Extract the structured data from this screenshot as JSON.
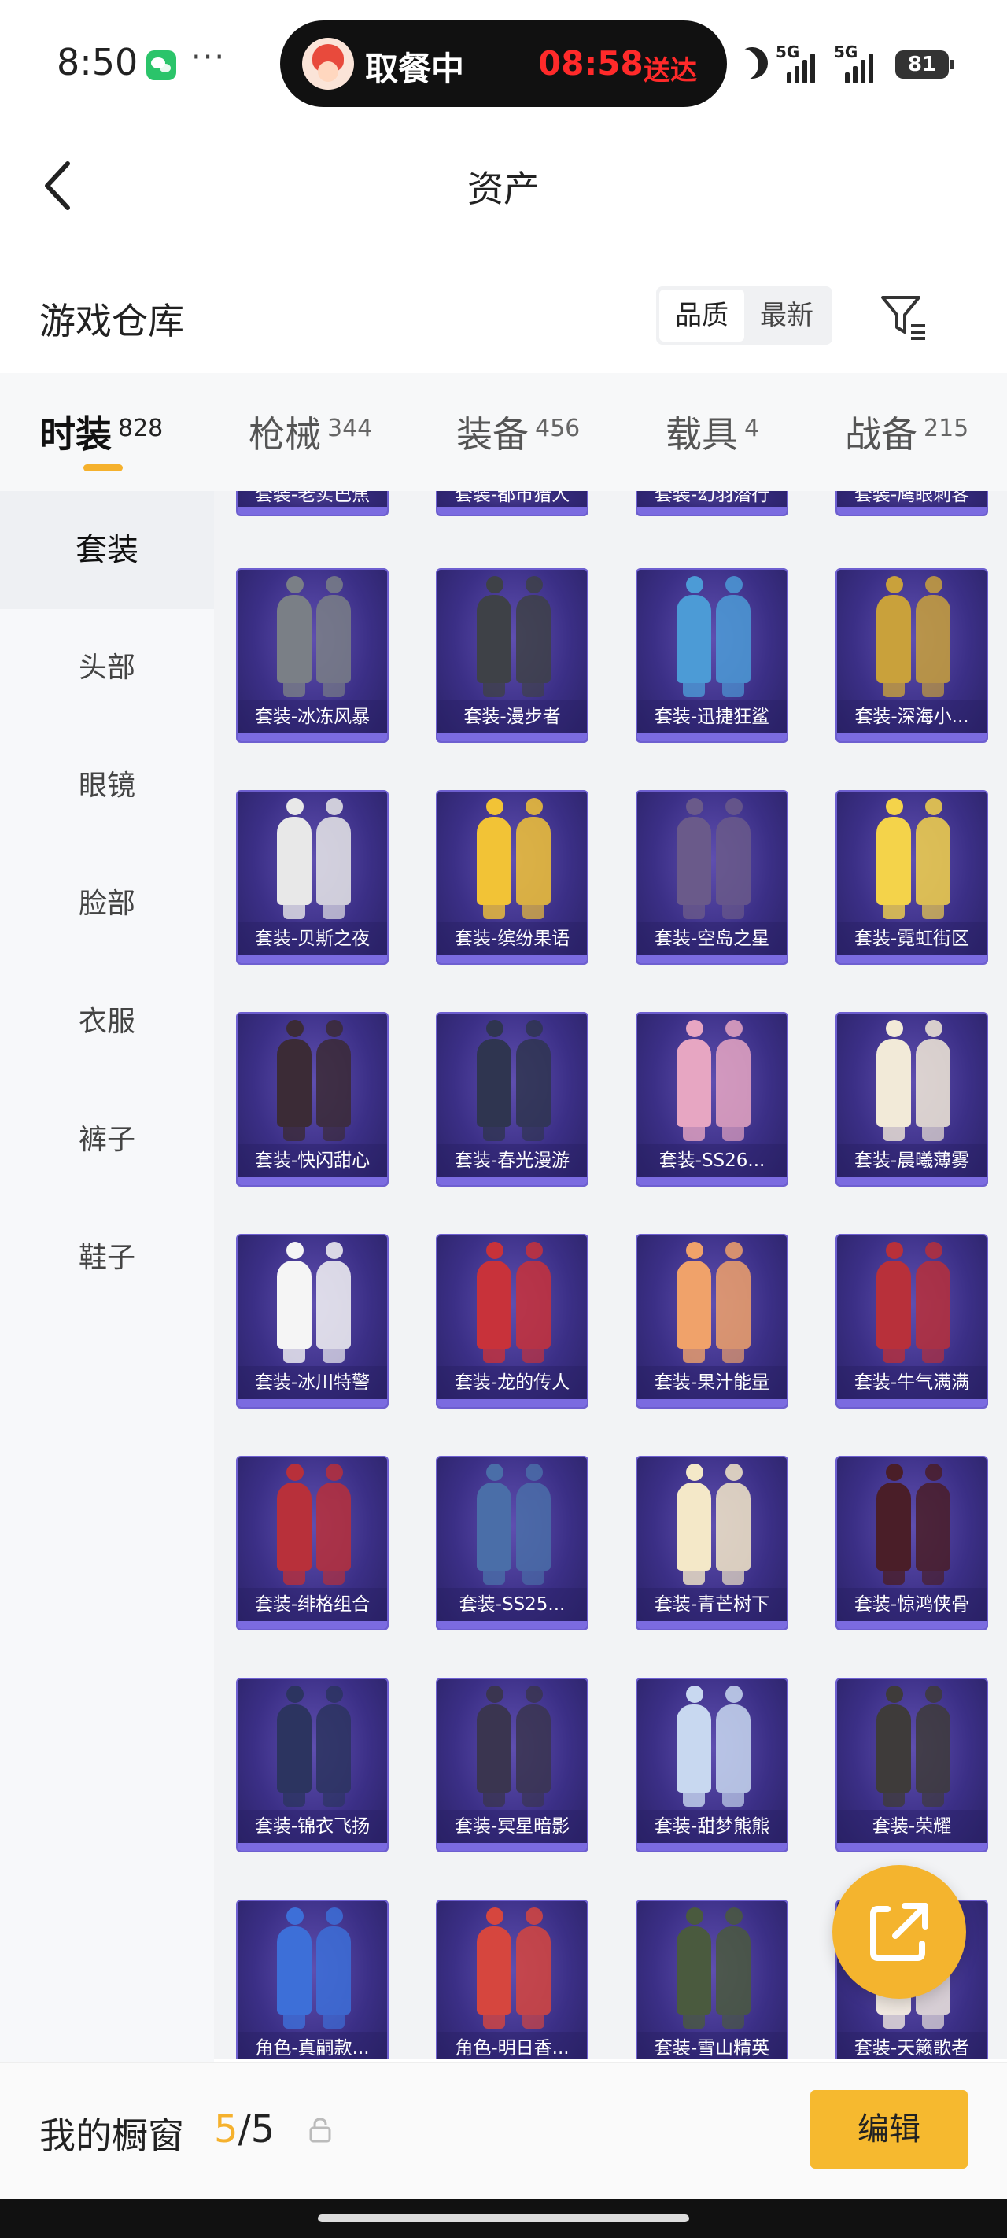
{
  "status_bar": {
    "time": "8:50",
    "more": "···",
    "island_title": "取餐中",
    "island_timer": "08:58",
    "island_tag": "送达",
    "signal_1": "5G",
    "signal_2": "5G",
    "battery": "81"
  },
  "header": {
    "title": "资产"
  },
  "warehouse": {
    "title": "游戏仓库",
    "sort_quality": "品质",
    "sort_newest": "最新"
  },
  "tabs": [
    {
      "label": "时装",
      "count": "828",
      "active": true
    },
    {
      "label": "枪械",
      "count": "344"
    },
    {
      "label": "装备",
      "count": "456"
    },
    {
      "label": "载具",
      "count": "4"
    },
    {
      "label": "战备",
      "count": "215"
    }
  ],
  "sidebar": {
    "items": [
      {
        "label": "套装",
        "active": true
      },
      {
        "label": "头部"
      },
      {
        "label": "眼镜"
      },
      {
        "label": "脸部"
      },
      {
        "label": "衣服"
      },
      {
        "label": "裤子"
      },
      {
        "label": "鞋子"
      }
    ]
  },
  "grid": {
    "partial_row": [
      "套装-老实巴焦",
      "套装-都市猎人",
      "套装-幻羽潜行",
      "套装-鹰眼刺客"
    ],
    "items": [
      [
        "套装-冰冻风暴",
        "套装-漫步者",
        "套装-迅捷狂鲨",
        "套装-深海小..."
      ],
      [
        "套装-贝斯之夜",
        "套装-缤纷果语",
        "套装-空岛之星",
        "套装-霓虹街区"
      ],
      [
        "套装-快闪甜心",
        "套装-春光漫游",
        "套装-SS26...",
        "套装-晨曦薄雾"
      ],
      [
        "套装-冰川特警",
        "套装-龙的传人",
        "套装-果汁能量",
        "套装-牛气满满"
      ],
      [
        "套装-绯格组合",
        "套装-SS25...",
        "套装-青芒树下",
        "套装-惊鸿侠骨"
      ],
      [
        "套装-锦衣飞扬",
        "套装-冥星暗影",
        "套装-甜梦熊熊",
        "套装-荣耀"
      ],
      [
        "角色-真嗣款...",
        "角色-明日香...",
        "套装-雪山精英",
        "套装-天籁歌者"
      ]
    ],
    "figure_colors": [
      [
        "#7a7f86",
        "#3e4147",
        "#4c9bd6",
        "#c9a13b"
      ],
      [
        "#e8e8e8",
        "#f2c336",
        "#6a5a8a",
        "#f4d34a"
      ],
      [
        "#3b2b36",
        "#2f3550",
        "#e7a6c2",
        "#f2ead8"
      ],
      [
        "#f5f5f5",
        "#c8323a",
        "#f0a26a",
        "#b8303a"
      ],
      [
        "#b8303a",
        "#4a6ea8",
        "#f4e8c8",
        "#4a1e28"
      ],
      [
        "#2c3460",
        "#3a3550",
        "#c8d8f0",
        "#3e3b3a"
      ],
      [
        "#3d6fd8",
        "#d6463e",
        "#4a5a3e",
        "#f0e8e0"
      ]
    ]
  },
  "fab": {
    "icon": "external-share-icon"
  },
  "showcase": {
    "label": "我的橱窗",
    "current": "5",
    "total": "/5",
    "edit_label": "编辑"
  }
}
